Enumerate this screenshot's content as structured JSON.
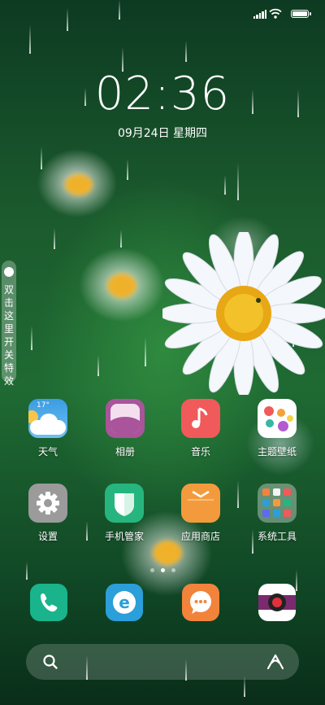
{
  "status_bar": {
    "icons": [
      "signal-icon",
      "wifi-icon",
      "battery-icon"
    ],
    "battery_level": 1.0
  },
  "lock": {
    "time": "02:36",
    "date": "09月24日 星期四"
  },
  "side_toggle": {
    "label": "双击这里开关特效"
  },
  "apps": [
    {
      "name": "天气",
      "icon": "weather-icon",
      "weather_temp": "17°"
    },
    {
      "name": "相册",
      "icon": "gallery-icon"
    },
    {
      "name": "音乐",
      "icon": "music-icon"
    },
    {
      "name": "主题壁纸",
      "icon": "themes-icon"
    },
    {
      "name": "设置",
      "icon": "settings-icon"
    },
    {
      "name": "手机管家",
      "icon": "security-icon"
    },
    {
      "name": "应用商店",
      "icon": "app-store-icon"
    },
    {
      "name": "系统工具",
      "icon": "folder-icon"
    }
  ],
  "pages": {
    "count": 3,
    "active": 2
  },
  "dock": [
    {
      "icon": "phone-icon"
    },
    {
      "icon": "browser-icon"
    },
    {
      "icon": "messages-icon"
    },
    {
      "icon": "camera-icon"
    }
  ],
  "search": {
    "icons": [
      "search-icon",
      "assistant-icon"
    ]
  },
  "colors": {
    "gallery": "#a9549b",
    "music": "#f05a5a",
    "settings": "#9b9b9b",
    "security": "#27b57f",
    "app_store": "#f39b3c",
    "phone": "#19b48c",
    "browser": "#2a9fd9",
    "messages": "#f2833b"
  }
}
